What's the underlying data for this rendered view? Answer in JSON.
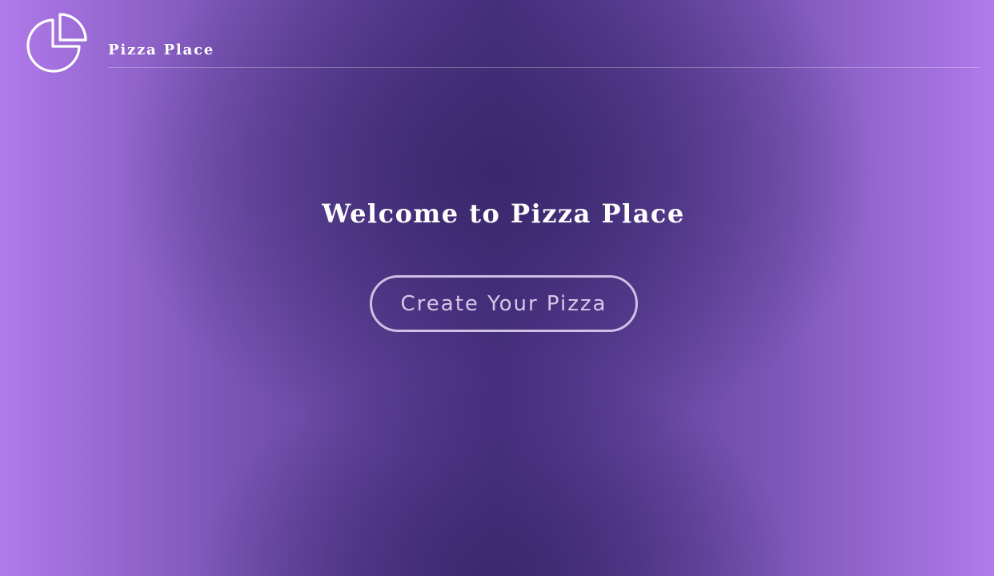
{
  "header": {
    "logo_icon": "pie-chart-icon",
    "brand_name": "Pizza Place"
  },
  "main": {
    "welcome_title": "Welcome to Pizza Place",
    "cta_label": "Create Your Pizza"
  },
  "colors": {
    "background_edge": "#b07aea",
    "background_center": "#4c3486",
    "text": "#ffffff",
    "button_border": "#e6d7f5"
  }
}
